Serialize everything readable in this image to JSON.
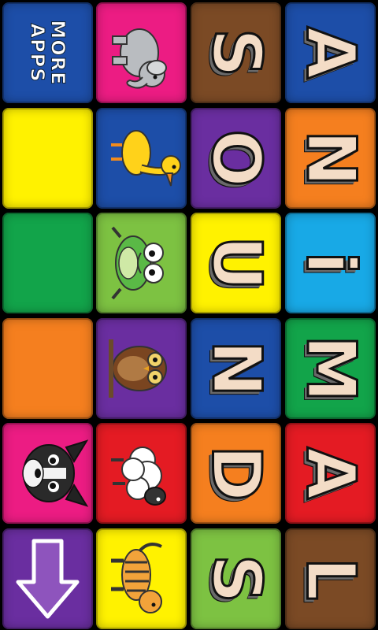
{
  "app": {
    "title_letters": [
      "A",
      "N",
      "I",
      "M",
      "A",
      "L",
      "S",
      "O",
      "U",
      "N",
      "D",
      "S"
    ],
    "more_apps_label": "MORE APPS",
    "colors": {
      "blue": "#1d4ea8",
      "pink": "#ec1c83",
      "brown": "#7b4a25",
      "yellow": "#fff200",
      "purple": "#6a2ea0",
      "orange": "#f57f1f",
      "green": "#12a44a",
      "lightgreen": "#7dc242",
      "cyan": "#18a9e6",
      "red": "#e41b23"
    }
  },
  "tiles": [
    {
      "row": 0,
      "col": 0,
      "color": "blue",
      "kind": "more"
    },
    {
      "row": 0,
      "col": 1,
      "color": "pink",
      "kind": "animal",
      "icon": "elephant-icon"
    },
    {
      "row": 0,
      "col": 2,
      "color": "brown",
      "kind": "letter",
      "letter": "S"
    },
    {
      "row": 0,
      "col": 3,
      "color": "blue",
      "kind": "letter",
      "letter": "A"
    },
    {
      "row": 1,
      "col": 0,
      "color": "yellow",
      "kind": "blank"
    },
    {
      "row": 1,
      "col": 1,
      "color": "blue",
      "kind": "animal",
      "icon": "duck-icon"
    },
    {
      "row": 1,
      "col": 2,
      "color": "purple",
      "kind": "letter",
      "letter": "O"
    },
    {
      "row": 1,
      "col": 3,
      "color": "orange",
      "kind": "letter",
      "letter": "N"
    },
    {
      "row": 2,
      "col": 0,
      "color": "green",
      "kind": "blank"
    },
    {
      "row": 2,
      "col": 1,
      "color": "lightgreen",
      "kind": "animal",
      "icon": "frog-icon"
    },
    {
      "row": 2,
      "col": 2,
      "color": "yellow",
      "kind": "letter",
      "letter": "U"
    },
    {
      "row": 2,
      "col": 3,
      "color": "cyan",
      "kind": "letter",
      "letter": "i"
    },
    {
      "row": 3,
      "col": 0,
      "color": "orange",
      "kind": "blank"
    },
    {
      "row": 3,
      "col": 1,
      "color": "purple",
      "kind": "animal",
      "icon": "owl-icon"
    },
    {
      "row": 3,
      "col": 2,
      "color": "blue",
      "kind": "letter",
      "letter": "N"
    },
    {
      "row": 3,
      "col": 3,
      "color": "green",
      "kind": "letter",
      "letter": "M"
    },
    {
      "row": 4,
      "col": 0,
      "color": "pink",
      "kind": "animal",
      "icon": "dog-icon"
    },
    {
      "row": 4,
      "col": 1,
      "color": "red",
      "kind": "animal",
      "icon": "sheep-icon"
    },
    {
      "row": 4,
      "col": 2,
      "color": "orange",
      "kind": "letter",
      "letter": "D"
    },
    {
      "row": 4,
      "col": 3,
      "color": "red",
      "kind": "letter",
      "letter": "A"
    },
    {
      "row": 5,
      "col": 0,
      "color": "purple",
      "kind": "arrow",
      "icon": "down-arrow-icon"
    },
    {
      "row": 5,
      "col": 1,
      "color": "yellow",
      "kind": "animal",
      "icon": "tiger-icon"
    },
    {
      "row": 5,
      "col": 2,
      "color": "lightgreen",
      "kind": "letter",
      "letter": "S"
    },
    {
      "row": 5,
      "col": 3,
      "color": "brown",
      "kind": "letter",
      "letter": "L"
    }
  ]
}
